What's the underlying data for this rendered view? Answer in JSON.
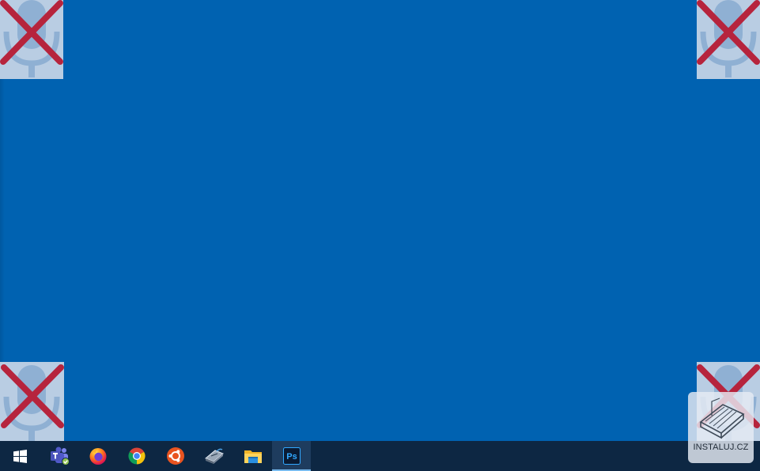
{
  "desktop": {
    "background_color": "#0062b1",
    "corner_overlays": [
      {
        "icon": "muted-microphone-icon",
        "position": "top-left"
      },
      {
        "icon": "muted-microphone-icon",
        "position": "top-right"
      },
      {
        "icon": "muted-microphone-icon",
        "position": "bottom-left"
      },
      {
        "icon": "muted-microphone-icon",
        "position": "bottom-right"
      }
    ]
  },
  "taskbar": {
    "background_color": "#0d2743",
    "items": [
      {
        "name": "start",
        "icon": "windows-logo-icon"
      },
      {
        "name": "microsoft-teams",
        "icon": "teams-icon"
      },
      {
        "name": "firefox",
        "icon": "firefox-icon"
      },
      {
        "name": "chrome",
        "icon": "chrome-icon"
      },
      {
        "name": "ubuntu",
        "icon": "ubuntu-icon"
      },
      {
        "name": "remote-app",
        "icon": "app-icon"
      },
      {
        "name": "file-explorer",
        "icon": "folder-icon"
      },
      {
        "name": "photoshop",
        "icon": "photoshop-icon",
        "label": "Ps",
        "active": true
      }
    ]
  },
  "watermark": {
    "text": "INSTALUJ.CZ"
  }
}
